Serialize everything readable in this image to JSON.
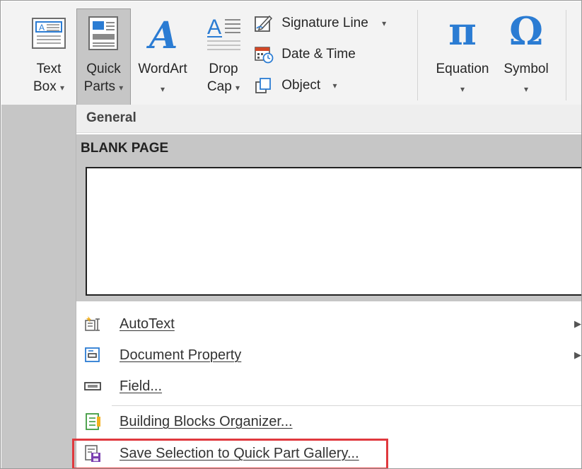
{
  "ribbon": {
    "text_box": {
      "line1": "Text",
      "line2": "Box",
      "caret": "▾"
    },
    "quick_parts": {
      "line1": "Quick",
      "line2": "Parts",
      "caret": "▾"
    },
    "wordart": {
      "line1": "WordArt",
      "caret": "▾"
    },
    "drop_cap": {
      "line1": "Drop",
      "line2": "Cap",
      "caret": "▾"
    },
    "signature_line": {
      "label": "Signature Line",
      "caret": "▾"
    },
    "date_time": {
      "label": "Date & Time"
    },
    "object": {
      "label": "Object",
      "caret": "▾"
    },
    "equation": {
      "glyph": "π",
      "label": "Equation",
      "caret": "▾"
    },
    "symbol": {
      "glyph": "Ω",
      "label": "Symbol",
      "caret": "▾"
    }
  },
  "dropdown": {
    "section_header": "General",
    "gallery_item_title": "BLANK PAGE",
    "menu": [
      {
        "label": "AutoText",
        "icon": "autotext-icon",
        "has_submenu": true,
        "arrow": "▶"
      },
      {
        "label": "Document Property",
        "icon": "document-property-icon",
        "has_submenu": true,
        "arrow": "▶"
      },
      {
        "label": "Field...",
        "icon": "field-icon",
        "has_submenu": false
      },
      {
        "label": "Building Blocks Organizer...",
        "icon": "building-blocks-icon",
        "has_submenu": false
      },
      {
        "label": "Save Selection to Quick Part Gallery...",
        "icon": "save-selection-icon",
        "has_submenu": false
      }
    ]
  },
  "colors": {
    "ribbon_bg": "#f3f3f3",
    "highlight_bg": "#c6c6c6",
    "accent_blue": "#2b7cd3",
    "annotation_red": "#e0393e"
  }
}
